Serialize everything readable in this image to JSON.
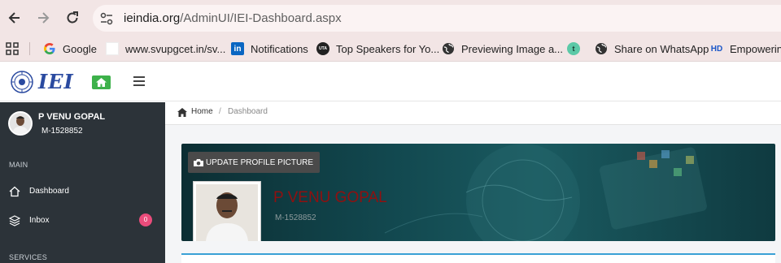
{
  "browser": {
    "url_host": "ieindia.org",
    "url_path": "/AdminUI/IEI-Dashboard.aspx",
    "bookmarks": [
      {
        "label": "Google",
        "icon": "google-icon"
      },
      {
        "label": "www.svupgcet.in/sv...",
        "icon": "blank-page-icon"
      },
      {
        "label": "Notifications",
        "icon": "linkedin-icon"
      },
      {
        "label": "Top Speakers for Yo...",
        "icon": "uta-icon"
      },
      {
        "label": "Previewing Image a...",
        "icon": "globe-icon"
      },
      {
        "label": "",
        "icon": "t-circle-icon"
      },
      {
        "label": "Share on WhatsApp",
        "icon": "globe-icon"
      },
      {
        "label": "Empowering",
        "icon": "hd-icon"
      }
    ]
  },
  "header": {
    "logo_text": "IEI"
  },
  "sidebar": {
    "user_name": "P VENU GOPAL",
    "user_id": "M-1528852",
    "sections": [
      "MAIN",
      "SERVICES"
    ],
    "items": [
      {
        "label": "Dashboard",
        "icon": "home-icon"
      },
      {
        "label": "Inbox",
        "icon": "layers-icon",
        "badge": "0"
      }
    ]
  },
  "breadcrumb": {
    "home": "Home",
    "separator": "/",
    "current": "Dashboard"
  },
  "banner": {
    "update_button": "UPDATE PROFILE PICTURE",
    "name": "P VENU GOPAL",
    "member_id": "M-1528852"
  },
  "colors": {
    "chrome_bg": "#f2e5e5",
    "sidebar_bg": "#2c3339",
    "home_button": "#3db14a",
    "badge": "#ea4c7b",
    "banner_name": "#8f1010",
    "accent_line": "#3aa1d6"
  }
}
